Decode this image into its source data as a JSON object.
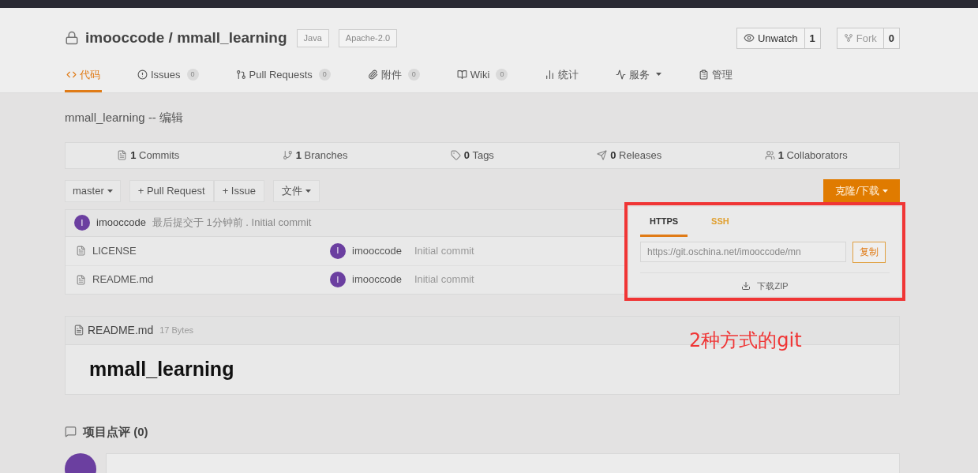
{
  "repo": {
    "owner": "imooccode",
    "separator": "/",
    "name": "mmall_learning",
    "tags": [
      "Java",
      "Apache-2.0"
    ]
  },
  "watch": {
    "label": "Unwatch",
    "count": "1"
  },
  "fork": {
    "label": "Fork",
    "count": "0",
    "disabled": true
  },
  "tabs": [
    {
      "label": "代码",
      "selected": true
    },
    {
      "label": "Issues",
      "count": "0",
      "selected": false
    },
    {
      "label": "Pull Requests",
      "count": "0",
      "selected": false
    },
    {
      "label": "附件",
      "count": "0",
      "selected": false
    },
    {
      "label": "Wiki",
      "count": "0",
      "selected": false
    },
    {
      "label": "统计",
      "selected": false
    },
    {
      "label": "服务",
      "selected": false,
      "has_menu": true
    },
    {
      "label": "管理",
      "selected": false
    }
  ],
  "subtitle": "mmall_learning -- 编辑",
  "stats": [
    {
      "count": "1",
      "label": "Commits"
    },
    {
      "count": "1",
      "label": "Branches"
    },
    {
      "count": "0",
      "label": "Tags"
    },
    {
      "count": "0",
      "label": "Releases"
    },
    {
      "count": "1",
      "label": "Collaborators"
    }
  ],
  "toolbar": {
    "branch": "master",
    "actions": [
      "+ Pull Request",
      "+ Issue"
    ],
    "file_menu": "文件",
    "clone_button": "克隆/下载"
  },
  "last_commit": {
    "avatar": "I",
    "author": "imooccode",
    "text": "最后提交于 1分钟前 . Initial commit"
  },
  "files": [
    {
      "name": "LICENSE",
      "avatar": "I",
      "author": "imooccode",
      "message": "Initial commit"
    },
    {
      "name": "README.md",
      "avatar": "I",
      "author": "imooccode",
      "message": "Initial commit"
    }
  ],
  "clone_menu": {
    "tabs": [
      {
        "label": "HTTPS",
        "selected": true
      },
      {
        "label": "SSH",
        "selected": false
      }
    ],
    "url": "https://git.oschina.net/imooccode/mn",
    "copy": "复制",
    "download": "下载ZIP"
  },
  "annotation": {
    "text": "2种方式的git"
  },
  "readme": {
    "filename": "README.md",
    "size": "17 Bytes",
    "heading": "mmall_learning"
  },
  "comments": {
    "title": "项目点评 (0)"
  }
}
